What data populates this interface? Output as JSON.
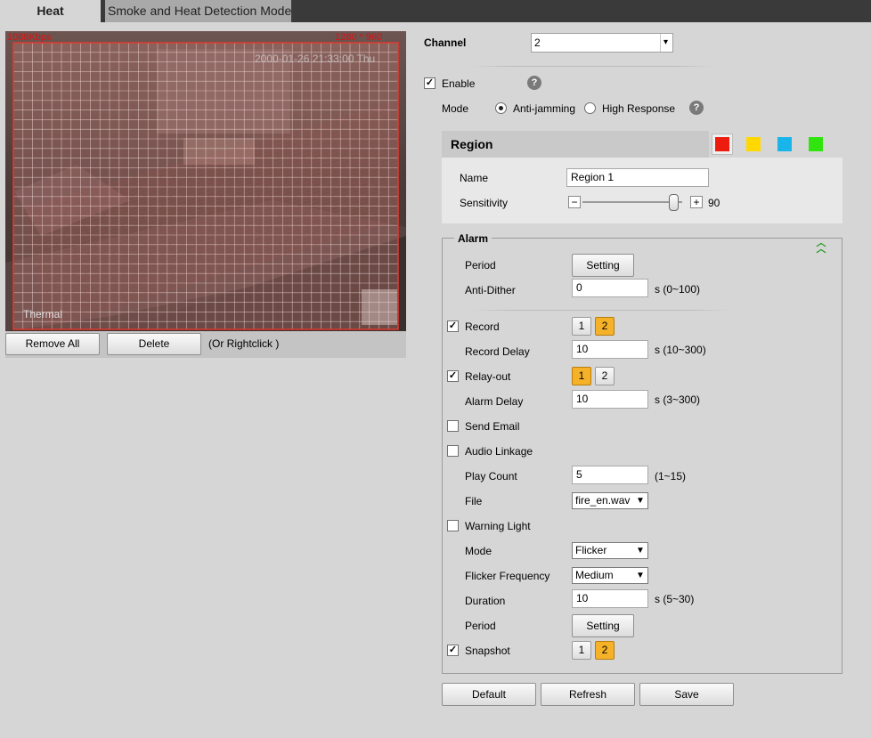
{
  "tabs": {
    "active": "Heat",
    "inactive": "Smoke and Heat Detection Mode"
  },
  "video": {
    "bitrate": "1088Kbps",
    "resolution": "1280 * 960",
    "timestamp": "2000-01-26 21:33:00 Thu",
    "watermark": "Thermal"
  },
  "video_toolbar": {
    "remove_all": "Remove All",
    "delete": "Delete",
    "hint": "(Or Rightclick )"
  },
  "channel": {
    "label": "Channel",
    "value": "2"
  },
  "enable": {
    "label": "Enable",
    "checked": true
  },
  "mode": {
    "label": "Mode",
    "options": [
      "Anti-jamming",
      "High Response"
    ],
    "selected": "Anti-jamming"
  },
  "help_icon": "?",
  "region": {
    "title": "Region",
    "colors": [
      "#ee1c0e",
      "#ffd800",
      "#19b5ea",
      "#2fe50d"
    ],
    "name_label": "Name",
    "name_value": "Region 1",
    "sensitivity_label": "Sensitivity",
    "sensitivity_value": "90",
    "minus": "−",
    "plus": "+"
  },
  "alarm": {
    "title": "Alarm",
    "collapse_icon": "double-chevron-up-icon",
    "period_label": "Period",
    "setting_button": "Setting",
    "anti_dither_label": "Anti-Dither",
    "anti_dither_value": "0",
    "anti_dither_range": "s (0~100)",
    "record": {
      "label": "Record",
      "checked": true,
      "channels": [
        "1",
        "2"
      ],
      "selected": "2"
    },
    "record_delay": {
      "label": "Record Delay",
      "value": "10",
      "range": "s (10~300)"
    },
    "relay_out": {
      "label": "Relay-out",
      "checked": true,
      "channels": [
        "1",
        "2"
      ],
      "selected": "1"
    },
    "alarm_delay": {
      "label": "Alarm Delay",
      "value": "10",
      "range": "s (3~300)"
    },
    "send_email": {
      "label": "Send Email",
      "checked": false
    },
    "audio_linkage": {
      "label": "Audio Linkage",
      "checked": false
    },
    "play_count": {
      "label": "Play Count",
      "value": "5",
      "range": "(1~15)"
    },
    "file": {
      "label": "File",
      "value": "fire_en.wav"
    },
    "warning_light": {
      "label": "Warning Light",
      "checked": false
    },
    "light_mode": {
      "label": "Mode",
      "value": "Flicker"
    },
    "flicker_frequency": {
      "label": "Flicker Frequency",
      "value": "Medium"
    },
    "duration": {
      "label": "Duration",
      "value": "10",
      "range": "s (5~30)"
    },
    "period2_label": "Period",
    "setting2_button": "Setting",
    "snapshot": {
      "label": "Snapshot",
      "checked": true,
      "channels": [
        "1",
        "2"
      ],
      "selected": "2"
    }
  },
  "footer": {
    "default": "Default",
    "refresh": "Refresh",
    "save": "Save"
  }
}
